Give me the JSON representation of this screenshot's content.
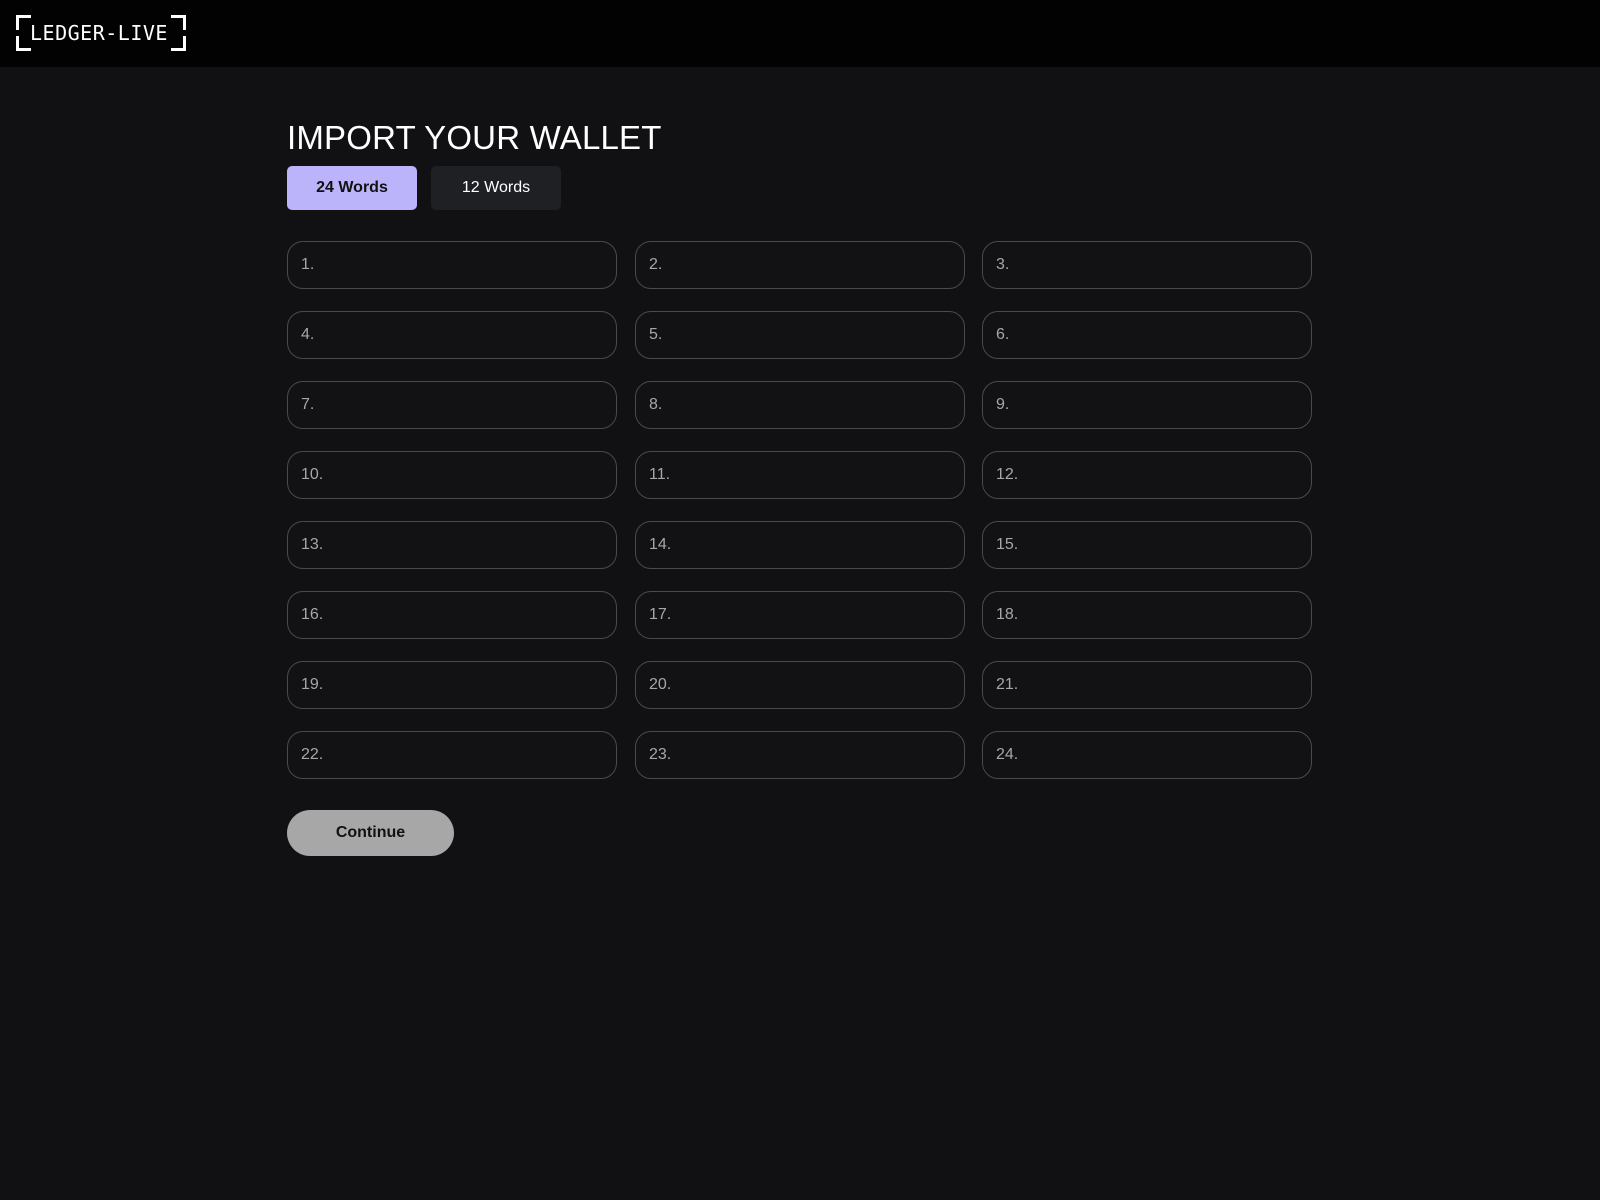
{
  "app": {
    "logo_text": "LEDGER-LIVE"
  },
  "page": {
    "title": "IMPORT YOUR WALLET",
    "tabs": [
      {
        "label": "24 Words",
        "active": true
      },
      {
        "label": "12 Words",
        "active": false
      }
    ],
    "words": [
      {
        "number": "1.",
        "value": ""
      },
      {
        "number": "2.",
        "value": ""
      },
      {
        "number": "3.",
        "value": ""
      },
      {
        "number": "4.",
        "value": ""
      },
      {
        "number": "5.",
        "value": ""
      },
      {
        "number": "6.",
        "value": ""
      },
      {
        "number": "7.",
        "value": ""
      },
      {
        "number": "8.",
        "value": ""
      },
      {
        "number": "9.",
        "value": ""
      },
      {
        "number": "10.",
        "value": ""
      },
      {
        "number": "11.",
        "value": ""
      },
      {
        "number": "12.",
        "value": ""
      },
      {
        "number": "13.",
        "value": ""
      },
      {
        "number": "14.",
        "value": ""
      },
      {
        "number": "15.",
        "value": ""
      },
      {
        "number": "16.",
        "value": ""
      },
      {
        "number": "17.",
        "value": ""
      },
      {
        "number": "18.",
        "value": ""
      },
      {
        "number": "19.",
        "value": ""
      },
      {
        "number": "20.",
        "value": ""
      },
      {
        "number": "21.",
        "value": ""
      },
      {
        "number": "22.",
        "value": ""
      },
      {
        "number": "23.",
        "value": ""
      },
      {
        "number": "24.",
        "value": ""
      }
    ],
    "continue_label": "Continue"
  },
  "colors": {
    "background": "#111113",
    "topbar": "#020202",
    "accent_tab": "#bcb4fb",
    "inactive_tab": "#1f2024",
    "field_border": "#4a4a4c",
    "continue_disabled": "#a7a7a7"
  }
}
